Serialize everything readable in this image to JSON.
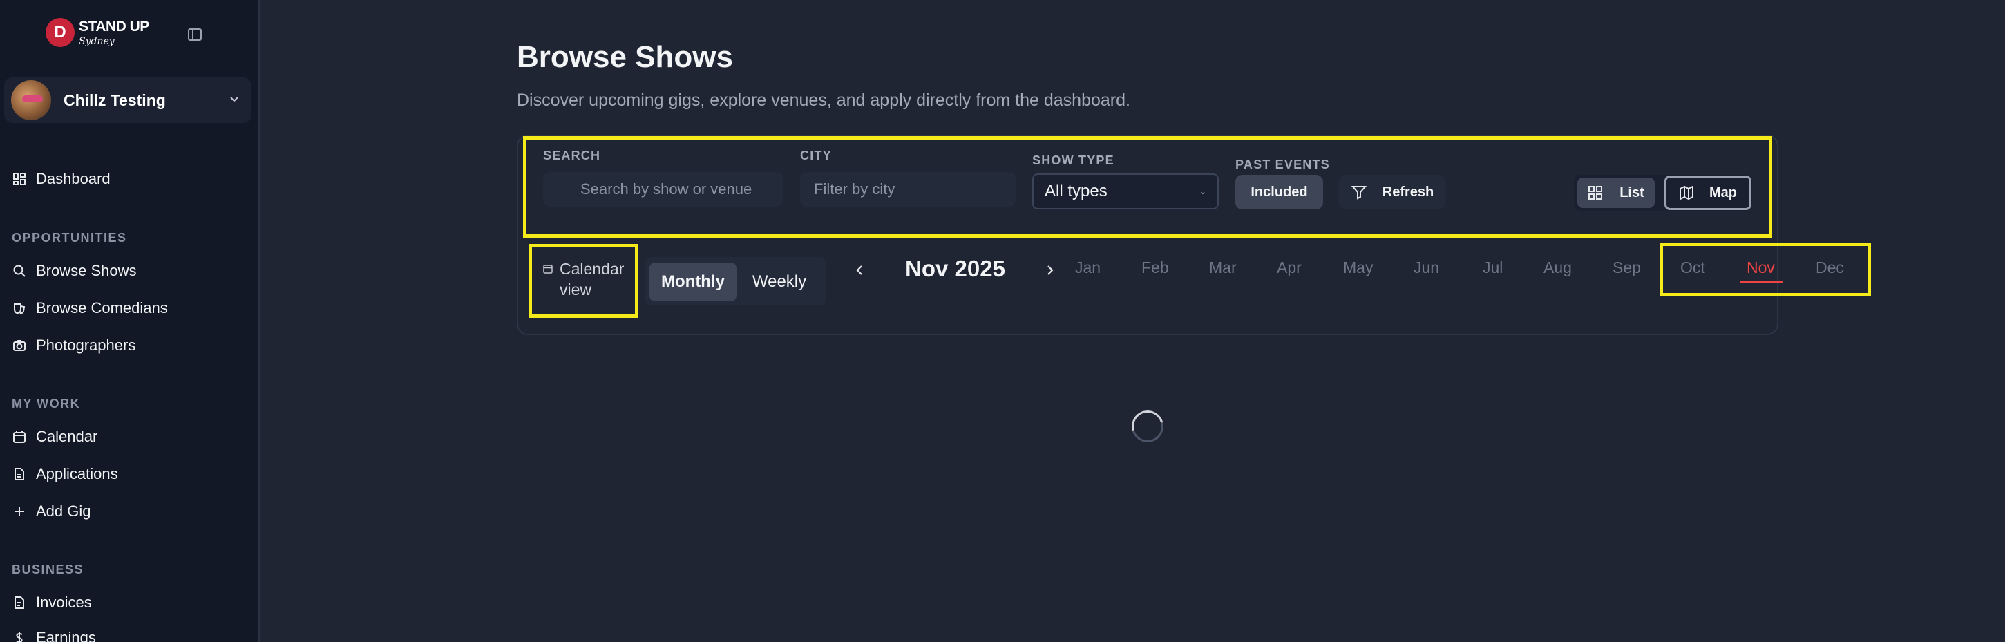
{
  "brand": {
    "title": "STAND UP",
    "subtitle": "Sydney",
    "mark": "D"
  },
  "user": {
    "name": "Chillz Testing"
  },
  "sidebar": {
    "dashboard": "Dashboard",
    "sections": [
      {
        "label": "OPPORTUNITIES",
        "items": [
          "Browse Shows",
          "Browse Comedians",
          "Photographers"
        ]
      },
      {
        "label": "MY WORK",
        "items": [
          "Calendar",
          "Applications",
          "Add Gig"
        ]
      },
      {
        "label": "BUSINESS",
        "items": [
          "Invoices",
          "Earnings"
        ]
      }
    ]
  },
  "page": {
    "title": "Browse Shows",
    "subtitle": "Discover upcoming gigs, explore venues, and apply directly from the dashboard."
  },
  "filters": {
    "search_label": "SEARCH",
    "search_placeholder": "Search by show or venue",
    "city_label": "CITY",
    "city_placeholder": "Filter by city",
    "show_type_label": "SHOW TYPE",
    "show_type_value": "All types",
    "past_events_label": "PAST EVENTS",
    "past_events_value": "Included",
    "refresh_label": "Refresh",
    "view_list_label": "List",
    "view_map_label": "Map"
  },
  "calendar": {
    "view_label": "Calendar view",
    "view_label_l1": "Calendar",
    "view_label_l2": "view",
    "mode_monthly": "Monthly",
    "mode_weekly": "Weekly",
    "current_month": "Nov 2025",
    "months": [
      "Jan",
      "Feb",
      "Mar",
      "Apr",
      "May",
      "Jun",
      "Jul",
      "Aug",
      "Sep",
      "Oct",
      "Nov",
      "Dec"
    ],
    "active_month": "Nov"
  },
  "colors": {
    "highlight": "#f5ea1a",
    "active_month": "#ef4444",
    "sidebar_bg": "#121826",
    "page_bg": "#1f2533"
  }
}
